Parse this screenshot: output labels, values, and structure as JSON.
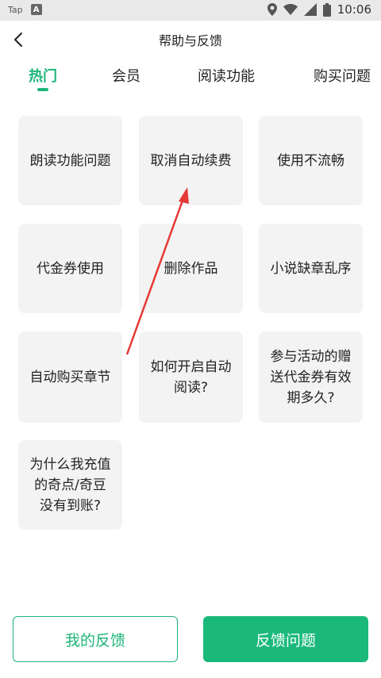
{
  "status_bar": {
    "app_label": "Tap",
    "notif_label": "A",
    "time": "10:06"
  },
  "header": {
    "title": "帮助与反馈",
    "back_icon": "chevron-left-icon"
  },
  "tabs": [
    {
      "label": "热门",
      "active": true
    },
    {
      "label": "会员",
      "active": false
    },
    {
      "label": "阅读功能",
      "active": false
    },
    {
      "label": "购买问题",
      "active": false
    }
  ],
  "questions": [
    "朗读功能问题",
    "取消自动续费",
    "使用不流畅",
    "代金券使用",
    "删除作品",
    "小说缺章乱序",
    "自动购买章节",
    "如何开启自动阅读?",
    "参与活动的赠送代金券有效期多久?",
    "为什么我充值的奇点/奇豆没有到账?"
  ],
  "footer": {
    "my_feedback": "我的反馈",
    "submit_feedback": "反馈问题"
  },
  "colors": {
    "accent": "#1eb47a",
    "annotation_arrow": "#e53935"
  }
}
